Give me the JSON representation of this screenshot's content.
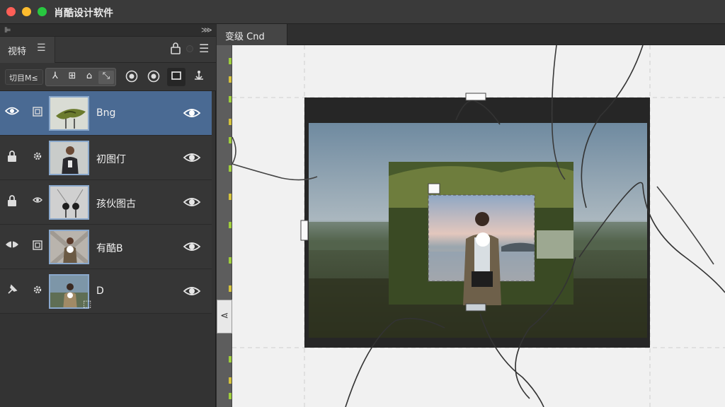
{
  "window": {
    "title": "肖酷设计软件"
  },
  "panel": {
    "tab_label": "视特",
    "filter_label": "切目M≤",
    "tools": [
      "⅄",
      "⊞",
      "⌂",
      "⤡"
    ]
  },
  "layers": [
    {
      "name": "Bng",
      "selected": true,
      "left_icon": "eye-icon"
    },
    {
      "name": "初图仃",
      "selected": false,
      "left_icon": "lock-icon"
    },
    {
      "name": "孩伙图古",
      "selected": false,
      "left_icon": "lock-icon"
    },
    {
      "name": "有酷B",
      "selected": false,
      "left_icon": "mask-icon"
    },
    {
      "name": "D",
      "selected": false,
      "left_icon": "pin-icon"
    }
  ],
  "document": {
    "tab_label": "变级 Cnd"
  },
  "colors": {
    "selected_layer": "#4a6a93",
    "accent_green": "#9fce3c"
  }
}
